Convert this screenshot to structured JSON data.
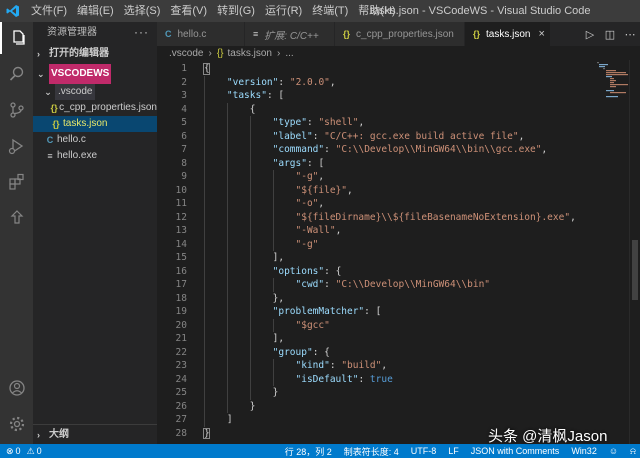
{
  "window": {
    "title": "tasks.json - VSCodeWS - Visual Studio Code",
    "menu": [
      "文件(F)",
      "编辑(E)",
      "选择(S)",
      "查看(V)",
      "转到(G)",
      "运行(R)",
      "终端(T)",
      "帮助(H)"
    ]
  },
  "sidebar": {
    "title": "资源管理器",
    "more": "···",
    "open_editors": "打开的编辑器",
    "workspace": "VSCODEWS",
    "folder": ".vscode",
    "files": [
      {
        "name": "c_cpp_properties.json",
        "icon": "{}",
        "color": "#cbcb41"
      },
      {
        "name": "tasks.json",
        "icon": "{}",
        "color": "#cbcb41"
      },
      {
        "name": "hello.c",
        "icon": "C",
        "color": "#519aba"
      },
      {
        "name": "hello.exe",
        "icon": "≡",
        "color": "#cccccc"
      }
    ],
    "outline": "大纲"
  },
  "tabs": [
    {
      "label": "hello.c",
      "icon": "C"
    },
    {
      "label": "扩展: C/C++",
      "icon": "≡"
    },
    {
      "label": "c_cpp_properties.json",
      "icon": "{}"
    },
    {
      "label": "tasks.json",
      "icon": "{}",
      "close": "×"
    }
  ],
  "breadcrumb": {
    "folder": ".vscode",
    "file": "tasks.json",
    "tail": "..."
  },
  "editor": {
    "lines": [
      {
        "n": "1",
        "code": "{"
      },
      {
        "n": "2",
        "code": "    \"version\": \"2.0.0\","
      },
      {
        "n": "3",
        "code": "    \"tasks\": ["
      },
      {
        "n": "4",
        "code": "        {"
      },
      {
        "n": "5",
        "code": "            \"type\": \"shell\","
      },
      {
        "n": "6",
        "code": "            \"label\": \"C/C++: gcc.exe build active file\","
      },
      {
        "n": "7",
        "code": "            \"command\": \"C:\\\\Develop\\\\MinGW64\\\\bin\\\\gcc.exe\","
      },
      {
        "n": "8",
        "code": "            \"args\": ["
      },
      {
        "n": "9",
        "code": "                \"-g\","
      },
      {
        "n": "10",
        "code": "                \"${file}\","
      },
      {
        "n": "11",
        "code": "                \"-o\","
      },
      {
        "n": "12",
        "code": "                \"${fileDirname}\\\\${fileBasenameNoExtension}.exe\","
      },
      {
        "n": "13",
        "code": "                \"-Wall\","
      },
      {
        "n": "14",
        "code": "                \"-g\""
      },
      {
        "n": "15",
        "code": "            ],"
      },
      {
        "n": "16",
        "code": "            \"options\": {"
      },
      {
        "n": "17",
        "code": "                \"cwd\": \"C:\\\\Develop\\\\MinGW64\\\\bin\""
      },
      {
        "n": "18",
        "code": "            },"
      },
      {
        "n": "19",
        "code": "            \"problemMatcher\": ["
      },
      {
        "n": "20",
        "code": "                \"$gcc\""
      },
      {
        "n": "21",
        "code": "            ],"
      },
      {
        "n": "22",
        "code": "            \"group\": {"
      },
      {
        "n": "23",
        "code": "                \"kind\": \"build\","
      },
      {
        "n": "24",
        "code": "                \"isDefault\": true"
      },
      {
        "n": "25",
        "code": "            }"
      },
      {
        "n": "26",
        "code": "        }"
      },
      {
        "n": "27",
        "code": "    ]"
      },
      {
        "n": "28",
        "code": "}"
      }
    ]
  },
  "statusbar": {
    "errors": "0",
    "warnings": "0",
    "position": "行 28，列 2",
    "tab_size": "制表符长度: 4",
    "encoding": "UTF-8",
    "eol": "LF",
    "language": "JSON with Comments",
    "platform": "Win32"
  },
  "watermark": {
    "text": "头条 @清枫Jason"
  },
  "colors": {
    "accent": "#007acc",
    "selection": "#094771",
    "key": "#9cdcfe",
    "string": "#ce9178",
    "keyword": "#569cd6"
  }
}
